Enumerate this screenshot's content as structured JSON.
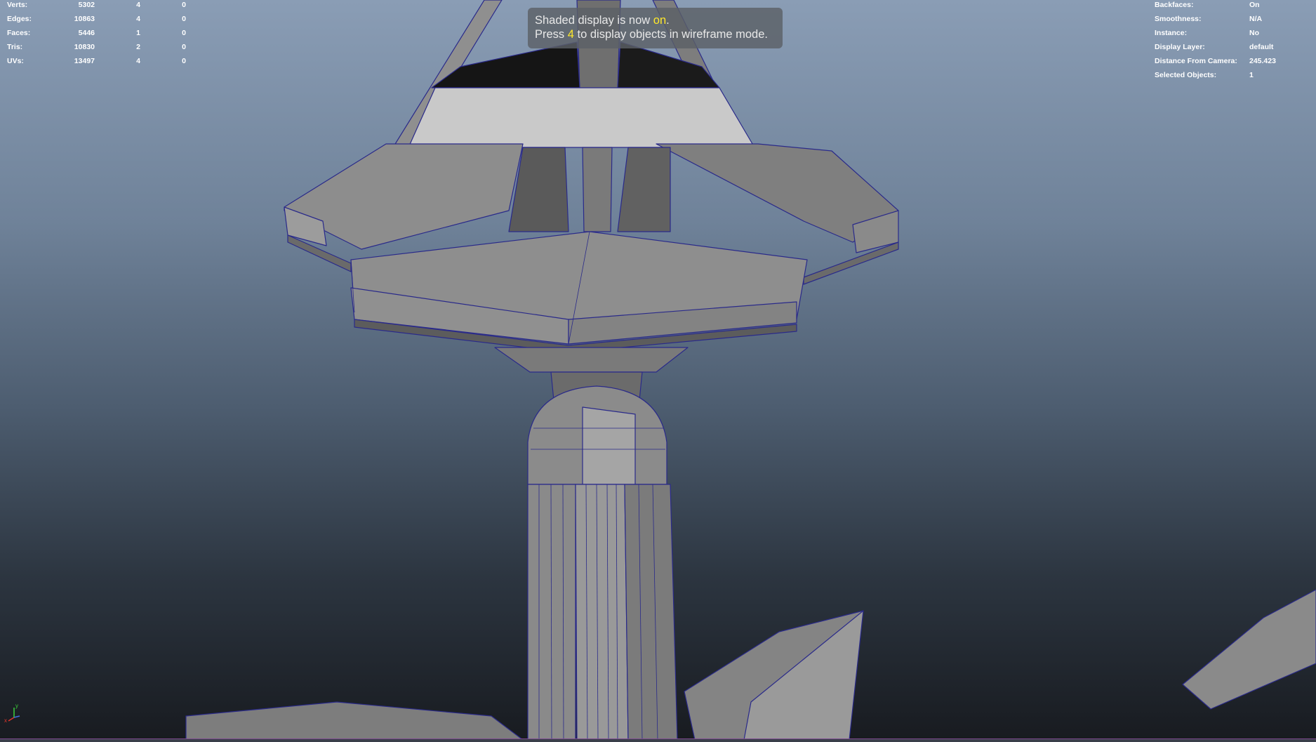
{
  "viewport": {
    "message": {
      "line1_prefix": "Shaded display is now ",
      "line1_highlight": "on",
      "line1_suffix": ".",
      "line2_prefix": "Press ",
      "line2_highlight": "4",
      "line2_suffix": " to display objects in wireframe mode."
    },
    "stats": [
      {
        "label": "Verts:",
        "v1": "5302",
        "v2": "4",
        "v3": "0"
      },
      {
        "label": "Edges:",
        "v1": "10863",
        "v2": "4",
        "v3": "0"
      },
      {
        "label": "Faces:",
        "v1": "5446",
        "v2": "1",
        "v3": "0"
      },
      {
        "label": "Tris:",
        "v1": "10830",
        "v2": "2",
        "v3": "0"
      },
      {
        "label": "UVs:",
        "v1": "13497",
        "v2": "4",
        "v3": "0"
      }
    ],
    "info": [
      {
        "label": "Backfaces:",
        "value": "On"
      },
      {
        "label": "Smoothness:",
        "value": "N/A"
      },
      {
        "label": "Instance:",
        "value": "No"
      },
      {
        "label": "Display Layer:",
        "value": "default"
      },
      {
        "label": "Distance From Camera:",
        "value": "245.423"
      },
      {
        "label": "Selected Objects:",
        "value": "1"
      }
    ],
    "axis": {
      "x": "x",
      "y": "y",
      "x_color": "#e0352b",
      "y_color": "#3bd13b",
      "z_color": "#3f6fe0"
    },
    "colors": {
      "highlight": "#ffe82a",
      "wire": "#2a2a8a",
      "model_gray": "#8c8c8c"
    }
  }
}
